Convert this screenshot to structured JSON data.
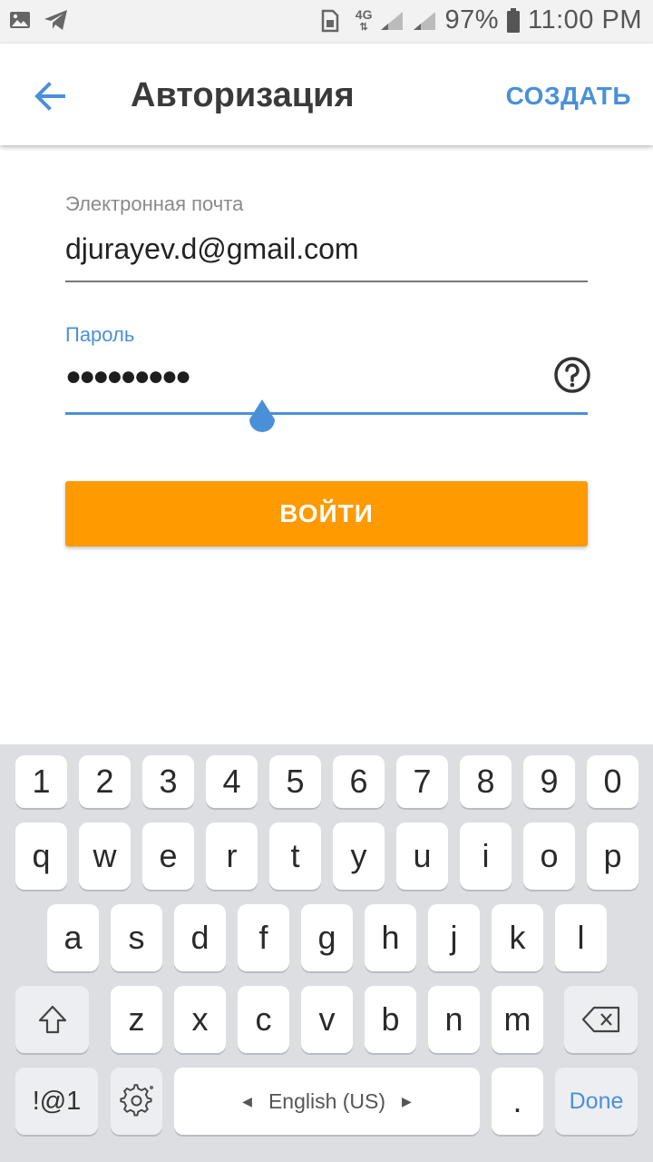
{
  "status_bar": {
    "battery_percent": "97%",
    "time": "11:00 PM",
    "network": "4G",
    "icons": [
      "image-icon",
      "telegram-icon",
      "sim-icon",
      "signal-icon",
      "battery-icon"
    ]
  },
  "app_bar": {
    "title": "Авторизация",
    "create_label": "СОЗДАТЬ",
    "back_icon": "arrow-back-icon"
  },
  "form": {
    "email_label": "Электронная почта",
    "email_value": "djurayev.d@gmail.com",
    "password_label": "Пароль",
    "password_value": "●●●●●●●●●",
    "help_icon": "question-circle-icon",
    "login_label": "ВОЙТИ"
  },
  "keyboard": {
    "row_numbers": [
      "1",
      "2",
      "3",
      "4",
      "5",
      "6",
      "7",
      "8",
      "9",
      "0"
    ],
    "row_1": [
      "q",
      "w",
      "e",
      "r",
      "t",
      "y",
      "u",
      "i",
      "o",
      "p"
    ],
    "row_2": [
      "a",
      "s",
      "d",
      "f",
      "g",
      "h",
      "j",
      "k",
      "l"
    ],
    "row_3": [
      "z",
      "x",
      "c",
      "v",
      "b",
      "n",
      "m"
    ],
    "symbols_label": "!@1",
    "space_label": "English (US)",
    "period_label": ".",
    "done_label": "Done"
  },
  "colors": {
    "accent": "#4a90d9",
    "button": "#ff9a00",
    "keyboard_bg": "#dcdee2"
  }
}
